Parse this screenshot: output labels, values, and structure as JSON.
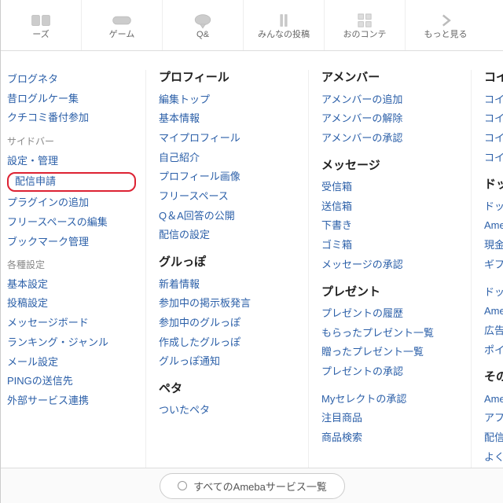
{
  "toolbar": [
    {
      "icon": "news",
      "label": "ーズ"
    },
    {
      "icon": "game",
      "label": "ゲーム"
    },
    {
      "icon": "qa",
      "label": "Q&"
    },
    {
      "icon": "social",
      "label": "みんなの投稿"
    },
    {
      "icon": "talk",
      "label": "おのコンテ"
    },
    {
      "icon": "more",
      "label": "もっと見る"
    }
  ],
  "col1": {
    "items1": [
      "ブログネタ",
      "昔ログルケー集",
      "クチコミ番付参加"
    ],
    "sub1": "サイドバー",
    "items2": [
      "設定・管理"
    ],
    "highlighted": "配信申請",
    "items3": [
      "プラグインの追加",
      "フリースペースの編集",
      "ブックマーク管理"
    ],
    "sub2": "各種設定",
    "items4": [
      "基本設定",
      "投稿設定",
      "メッセージボード",
      "ランキング・ジャンル",
      "メール設定",
      "PINGの送信先",
      "外部サービス連携"
    ]
  },
  "col2": {
    "h1": "プロフィール",
    "items1": [
      "編集トップ",
      "基本情報",
      "マイプロフィール",
      "自己紹介",
      "プロフィール画像",
      "フリースペース",
      "Q＆A回答の公開",
      "配信の設定"
    ],
    "h2": "グルっぽ",
    "items2": [
      "新着情報",
      "参加中の掲示板発言",
      "参加中のグルっぽ",
      "作成したグルっぽ",
      "グルっぽ通知"
    ],
    "h3": "ペタ",
    "items3": [
      "ついたペタ"
    ]
  },
  "col3": {
    "h1": "アメンバー",
    "items1": [
      "アメンバーの追加",
      "アメンバーの解除",
      "アメンバーの承認"
    ],
    "h2": "メッセージ",
    "items2": [
      "受信箱",
      "送信箱",
      "下書き",
      "ゴミ箱",
      "メッセージの承認"
    ],
    "h3": "プレゼント",
    "items3": [
      "プレゼントの履歴",
      "もらったプレゼント一覧",
      "贈ったプレゼント一覧",
      "プレゼントの承認"
    ],
    "items4": [
      "Myセレクトの承認",
      "注目商品",
      "商品検索"
    ]
  },
  "col4": {
    "h1": "コイン",
    "items1": [
      "コインの履歴",
      "コイン購入",
      "コイン獲得",
      "コイン履歴"
    ],
    "h2": "ドットマネ",
    "items2": [
      "ドットマネーで",
      "Amebaで使う",
      "現金に交換",
      "ギフト券・ポ"
    ],
    "items3": [
      "ドットマネーで",
      "Amebaで使う",
      "広告サービス",
      "ポイントで貯"
    ],
    "h3": "その他のサ",
    "items4": [
      "Amebaプレミ",
      "アフィリエイト",
      "配信広告の承認",
      "よくある質問"
    ]
  },
  "bottom": {
    "label": "すべてのAmebaサービス一覧"
  }
}
